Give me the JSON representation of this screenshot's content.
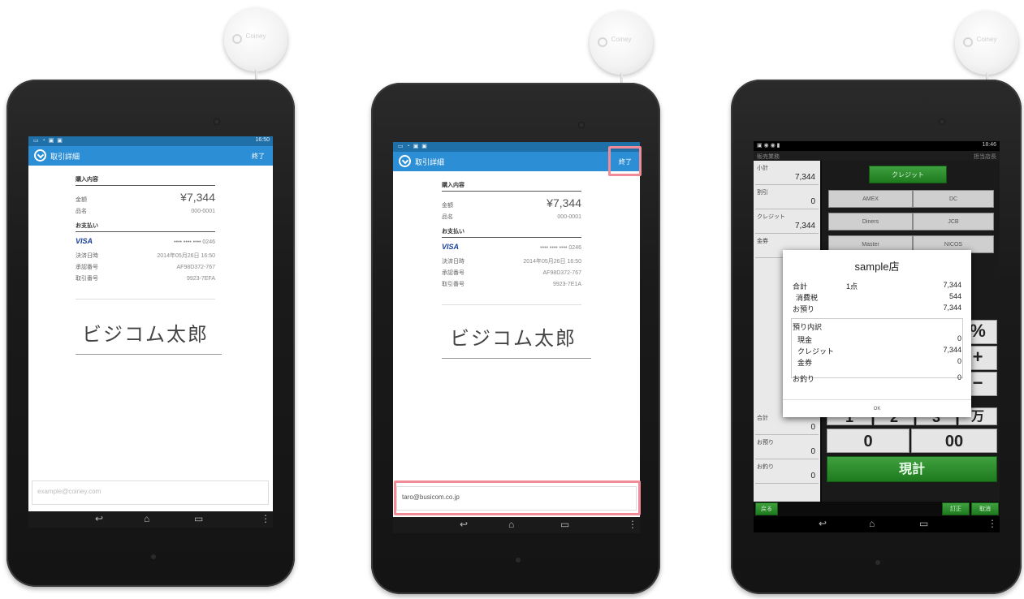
{
  "device1": {
    "reader_logo": "Coiney",
    "statusbar": {
      "time": "16:50"
    },
    "appbar": {
      "title": "取引詳細",
      "action": "終了"
    },
    "receipt": {
      "purchase_header": "購入内容",
      "total_label": "金額",
      "total_value": "¥7,344",
      "item_label": "品名",
      "item_value": "000-0001",
      "payment_header": "お支払い",
      "card_brand": "VISA",
      "card_number": "•••• •••• •••• 0246",
      "date_label": "決済日時",
      "date_value": "2014年05月26日 16:50",
      "approval_label": "承認番号",
      "approval_value": "AF98D372-767",
      "txn_label": "取引番号",
      "txn_value": "9923-7EFA"
    },
    "signature": "ビジコム太郎",
    "email_placeholder": "example@coiney.com"
  },
  "device2": {
    "reader_logo": "Coiney",
    "appbar": {
      "title": "取引詳細",
      "action": "終了"
    },
    "receipt": {
      "purchase_header": "購入内容",
      "total_label": "金額",
      "total_value": "¥7,344",
      "item_label": "品名",
      "item_value": "000-0001",
      "payment_header": "お支払い",
      "card_brand": "VISA",
      "card_number": "•••• •••• •••• 0246",
      "date_label": "決済日時",
      "date_value": "2014年05月26日 16:50",
      "approval_label": "承認番号",
      "approval_value": "AF98D372-767",
      "txn_label": "取引番号",
      "txn_value": "9923-7E1A"
    },
    "signature": "ビジコム太郎",
    "email_value": "taro@busicom.co.jp"
  },
  "device3": {
    "reader_logo": "Coiney",
    "statusbar": {
      "time": "18:46"
    },
    "header": {
      "left": "販売業務",
      "right": "担当店長"
    },
    "left_panel": [
      {
        "label": "小計",
        "value": "7,344"
      },
      {
        "label": "割引",
        "value": "0"
      },
      {
        "label": "クレジット",
        "value": "7,344"
      },
      {
        "label": "金券",
        "value": ""
      }
    ],
    "left_bottom": [
      {
        "label": "合計",
        "value": "0"
      },
      {
        "label": "お預り",
        "value": "0"
      },
      {
        "label": "お釣り",
        "value": "0"
      }
    ],
    "credit_button": "クレジット",
    "cards": [
      "AMEX",
      "DC",
      "Diners",
      "JCB",
      "Master",
      "NICOS"
    ],
    "keys": {
      "percent": "%",
      "plus": "+",
      "minus": "−",
      "one": "1",
      "two": "2",
      "three": "3",
      "man": "万",
      "zero": "0",
      "double_zero": "00",
      "genkei": "現計"
    },
    "bottom_buttons": {
      "back": "戻る",
      "correct": "訂正",
      "cancel": "取消"
    },
    "dialog": {
      "title": "sample店",
      "total_label": "合計",
      "total_count": "1点",
      "total_value": "7,344",
      "tax_label": "消費税",
      "tax_value": "544",
      "deposit_label": "お預り",
      "deposit_value": "7,344",
      "breakdown_label": "預り内訳",
      "cash_label": "現金",
      "cash_value": "0",
      "credit_label": "クレジット",
      "credit_value": "7,344",
      "voucher_label": "金券",
      "voucher_value": "0",
      "change_label": "お釣り",
      "change_value": "0",
      "ok_label": "OK"
    }
  },
  "nav_icons": [
    "back-icon",
    "home-icon",
    "recents-icon",
    "menu-icon"
  ]
}
